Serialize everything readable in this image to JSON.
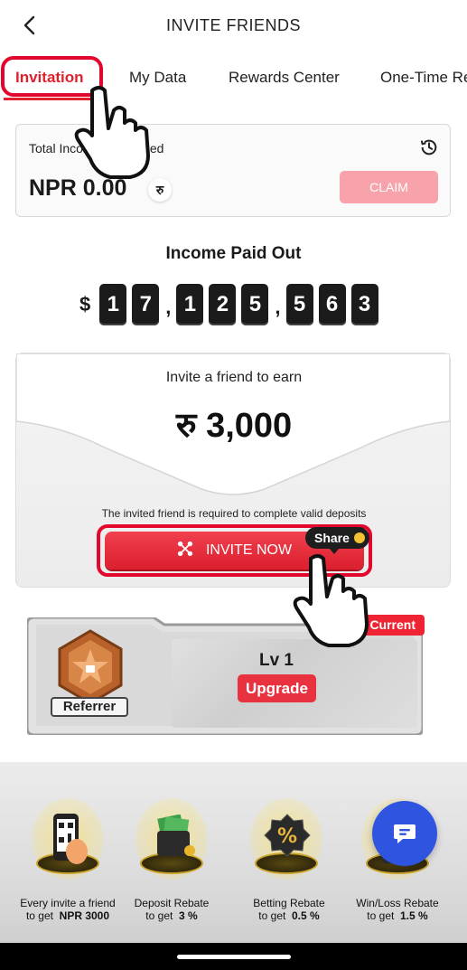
{
  "header": {
    "title": "INVITE FRIENDS",
    "back_icon": "chevron-left-icon"
  },
  "tabs": [
    {
      "label": "Invitation",
      "active": true
    },
    {
      "label": "My Data",
      "active": false
    },
    {
      "label": "Rewards Center",
      "active": false
    },
    {
      "label": "One-Time Re",
      "active": false
    }
  ],
  "income": {
    "label": "Total Income Unclaimed",
    "amount": "NPR 0.00",
    "currency_symbol": "रु",
    "claim_label": "CLAIM",
    "history_icon": "history-icon"
  },
  "paid_out": {
    "title": "Income Paid Out",
    "currency": "$",
    "groups": [
      [
        "1",
        "7"
      ],
      [
        "1",
        "2",
        "5"
      ],
      [
        "5",
        "6",
        "3"
      ]
    ],
    "separator": ","
  },
  "invite": {
    "earn_label": "Invite a friend to earn",
    "amount": "रु 3,000",
    "note": "The invited friend is required to complete valid deposits",
    "button_label": "INVITE NOW",
    "share_label": "Share"
  },
  "level": {
    "badge_label": "Referrer",
    "current_tag": "Current",
    "level_text": "Lv 1",
    "upgrade_label": "Upgrade"
  },
  "benefits": [
    {
      "line1": "Every invite a friend",
      "line2_prefix": "to get",
      "line2_value": "NPR 3000",
      "icon": "qr-phone-icon"
    },
    {
      "line1": "Deposit Rebate",
      "line2_prefix": "to get",
      "line2_value": "3 %",
      "icon": "wallet-icon"
    },
    {
      "line1": "Betting Rebate",
      "line2_prefix": "to get",
      "line2_value": "0.5 %",
      "icon": "percent-badge-icon"
    },
    {
      "line1": "Win/Loss Rebate",
      "line2_prefix": "to get",
      "line2_value": "1.5 %",
      "icon": "coin-chest-icon"
    }
  ],
  "colors": {
    "accent": "#e0202d",
    "claim_disabled": "#f8a3ab",
    "chat_fab": "#2f55e0"
  }
}
